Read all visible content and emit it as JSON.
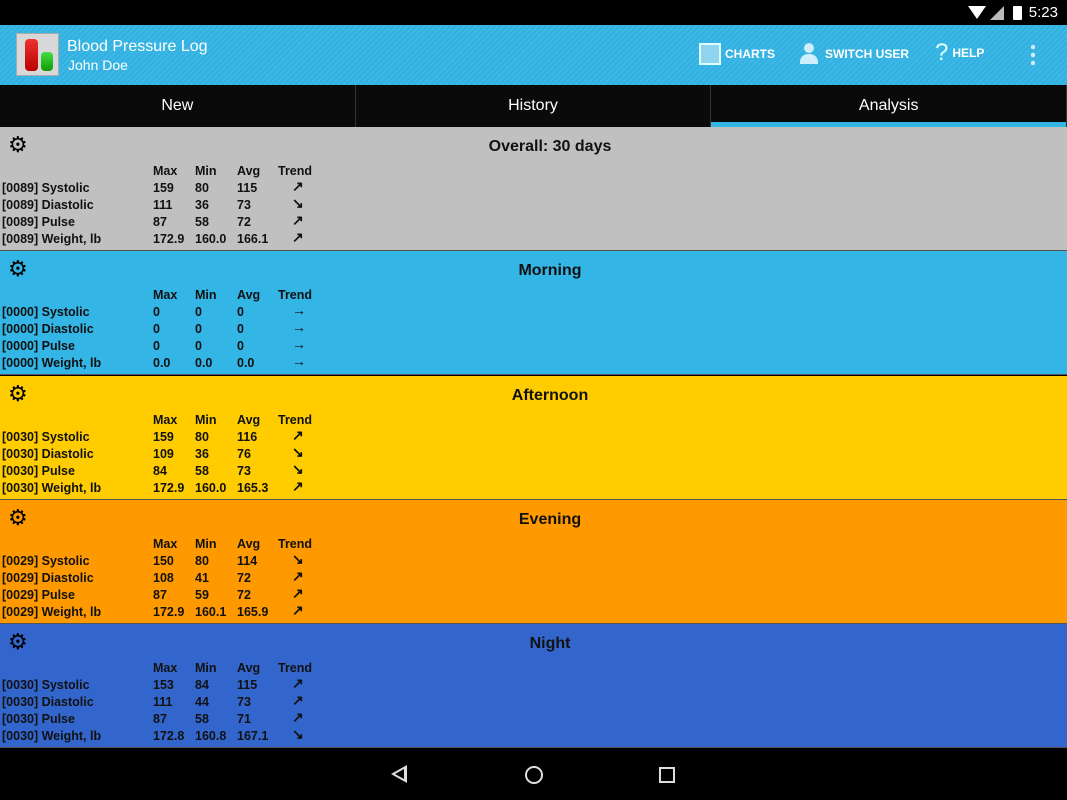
{
  "status_bar": {
    "time": "5:23"
  },
  "app_bar": {
    "title": "Blood Pressure Log",
    "user": "John Doe",
    "actions": {
      "charts": "CHARTS",
      "switch_user": "SWITCH USER",
      "help": "HELP"
    }
  },
  "tabs": [
    {
      "label": "New"
    },
    {
      "label": "History"
    },
    {
      "label": "Analysis",
      "active": true
    }
  ],
  "columns": {
    "max": "Max",
    "min": "Min",
    "avg": "Avg",
    "trend": "Trend"
  },
  "trend_glyphs": {
    "up": "↗",
    "down": "↘",
    "flat": "→"
  },
  "sections": [
    {
      "title": "Overall: 30 days",
      "color": "#c0c0c0",
      "rows": [
        {
          "label": "[0089] Systolic",
          "max": "159",
          "min": "80",
          "avg": "115",
          "trend": "up"
        },
        {
          "label": "[0089] Diastolic",
          "max": "111",
          "min": "36",
          "avg": "73",
          "trend": "down"
        },
        {
          "label": "[0089] Pulse",
          "max": "87",
          "min": "58",
          "avg": "72",
          "trend": "up"
        },
        {
          "label": "[0089] Weight,  lb",
          "max": "172.9",
          "min": "160.0",
          "avg": "166.1",
          "trend": "up"
        }
      ]
    },
    {
      "title": "Morning",
      "color": "#33b5e5",
      "rows": [
        {
          "label": "[0000] Systolic",
          "max": "0",
          "min": "0",
          "avg": "0",
          "trend": "flat"
        },
        {
          "label": "[0000] Diastolic",
          "max": "0",
          "min": "0",
          "avg": "0",
          "trend": "flat"
        },
        {
          "label": "[0000] Pulse",
          "max": "0",
          "min": "0",
          "avg": "0",
          "trend": "flat"
        },
        {
          "label": "[0000] Weight,  lb",
          "max": "0.0",
          "min": "0.0",
          "avg": "0.0",
          "trend": "flat"
        }
      ]
    },
    {
      "title": "Afternoon",
      "color": "#ffcc00",
      "rows": [
        {
          "label": "[0030] Systolic",
          "max": "159",
          "min": "80",
          "avg": "116",
          "trend": "up"
        },
        {
          "label": "[0030] Diastolic",
          "max": "109",
          "min": "36",
          "avg": "76",
          "trend": "down"
        },
        {
          "label": "[0030] Pulse",
          "max": "84",
          "min": "58",
          "avg": "73",
          "trend": "down"
        },
        {
          "label": "[0030] Weight,  lb",
          "max": "172.9",
          "min": "160.0",
          "avg": "165.3",
          "trend": "up"
        }
      ]
    },
    {
      "title": "Evening",
      "color": "#ff9900",
      "rows": [
        {
          "label": "[0029] Systolic",
          "max": "150",
          "min": "80",
          "avg": "114",
          "trend": "down"
        },
        {
          "label": "[0029] Diastolic",
          "max": "108",
          "min": "41",
          "avg": "72",
          "trend": "up"
        },
        {
          "label": "[0029] Pulse",
          "max": "87",
          "min": "59",
          "avg": "72",
          "trend": "up"
        },
        {
          "label": "[0029] Weight,  lb",
          "max": "172.9",
          "min": "160.1",
          "avg": "165.9",
          "trend": "up"
        }
      ]
    },
    {
      "title": "Night",
      "color": "#3366cc",
      "rows": [
        {
          "label": "[0030] Systolic",
          "max": "153",
          "min": "84",
          "avg": "115",
          "trend": "up"
        },
        {
          "label": "[0030] Diastolic",
          "max": "111",
          "min": "44",
          "avg": "73",
          "trend": "up"
        },
        {
          "label": "[0030] Pulse",
          "max": "87",
          "min": "58",
          "avg": "71",
          "trend": "up"
        },
        {
          "label": "[0030] Weight,  lb",
          "max": "172.8",
          "min": "160.8",
          "avg": "167.1",
          "trend": "down"
        }
      ]
    }
  ]
}
